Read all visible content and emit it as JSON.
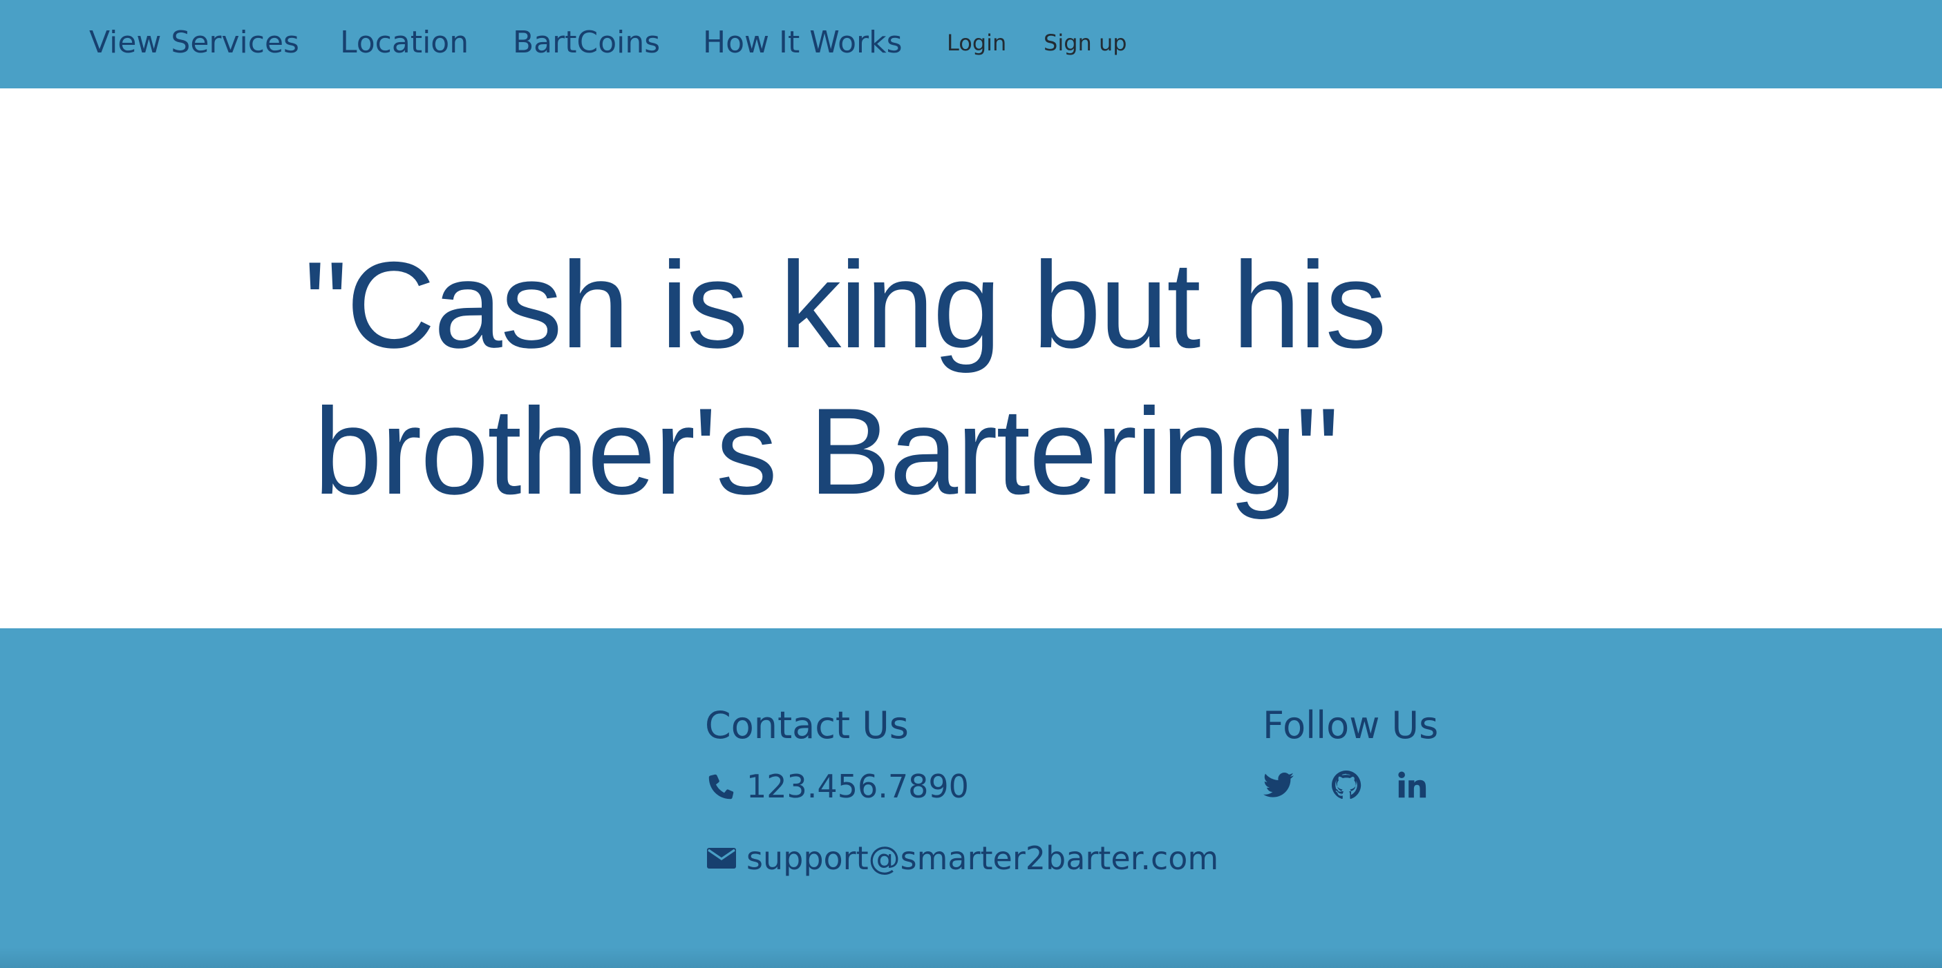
{
  "nav": {
    "links": [
      {
        "label": "View Services"
      },
      {
        "label": "Location"
      },
      {
        "label": "BartCoins"
      },
      {
        "label": "How It Works"
      },
      {
        "label": "Login"
      },
      {
        "label": "Sign up"
      }
    ]
  },
  "hero": {
    "quote_line1": "\"Cash is king but his",
    "quote_line2": "brother's Bartering\""
  },
  "footer": {
    "contact": {
      "heading": "Contact Us",
      "phone": "123.456.7890",
      "email": "support@smarter2barter.com",
      "phone_icon": "phone-icon",
      "email_icon": "envelope-icon"
    },
    "follow": {
      "heading": "Follow Us",
      "icons": [
        "twitter-icon",
        "github-icon",
        "linkedin-icon"
      ]
    }
  },
  "colors": {
    "primary_band": "#4aa0c6",
    "text_navy": "#17406f",
    "quote_navy": "#1a4578"
  }
}
